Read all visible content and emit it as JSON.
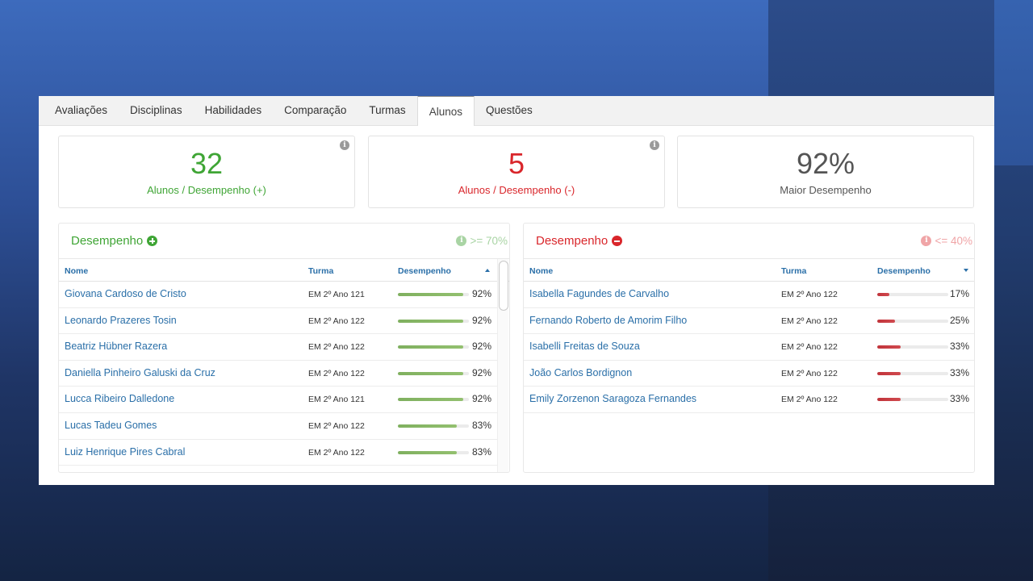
{
  "tabs": [
    {
      "label": "Avaliações",
      "active": false
    },
    {
      "label": "Disciplinas",
      "active": false
    },
    {
      "label": "Habilidades",
      "active": false
    },
    {
      "label": "Comparação",
      "active": false
    },
    {
      "label": "Turmas",
      "active": false
    },
    {
      "label": "Alunos",
      "active": true
    },
    {
      "label": "Questões",
      "active": false
    }
  ],
  "stats": [
    {
      "value": "32",
      "label": "Alunos / Desempenho (+)",
      "color": "#3fa535",
      "info_icon": "i"
    },
    {
      "value": "5",
      "label": "Alunos / Desempenho (-)",
      "color": "#d9262b",
      "info_icon": "i"
    },
    {
      "value": "92%",
      "label": "Maior Desempenho",
      "color": "#555555"
    }
  ],
  "positive": {
    "title": "Desempenho",
    "threshold": ">= 70%",
    "info_icon": "i",
    "columns": {
      "name": "Nome",
      "turma": "Turma",
      "desempenho": "Desempenho"
    },
    "sort": "ascending-icon",
    "rows": [
      {
        "name": "Giovana Cardoso de Cristo",
        "turma": "EM 2º Ano 121",
        "pct": "92%",
        "value": 92
      },
      {
        "name": "Leonardo Prazeres Tosin",
        "turma": "EM 2º Ano 122",
        "pct": "92%",
        "value": 92
      },
      {
        "name": "Beatriz Hübner Razera",
        "turma": "EM 2º Ano 122",
        "pct": "92%",
        "value": 92
      },
      {
        "name": "Daniella Pinheiro Galuski da Cruz",
        "turma": "EM 2º Ano 122",
        "pct": "92%",
        "value": 92
      },
      {
        "name": "Lucca Ribeiro Dalledone",
        "turma": "EM 2º Ano 121",
        "pct": "92%",
        "value": 92
      },
      {
        "name": "Lucas Tadeu Gomes",
        "turma": "EM 2º Ano 122",
        "pct": "83%",
        "value": 83
      },
      {
        "name": "Luiz Henrique Pires Cabral",
        "turma": "EM 2º Ano 122",
        "pct": "83%",
        "value": 83
      }
    ],
    "bar_color": "#85b565"
  },
  "negative": {
    "title": "Desempenho",
    "threshold": "<= 40%",
    "info_icon": "i",
    "columns": {
      "name": "Nome",
      "turma": "Turma",
      "desempenho": "Desempenho"
    },
    "sort": "descending-icon",
    "rows": [
      {
        "name": "Isabella Fagundes de Carvalho",
        "turma": "EM 2º Ano 122",
        "pct": "17%",
        "value": 17
      },
      {
        "name": "Fernando Roberto de Amorim Filho",
        "turma": "EM 2º Ano 122",
        "pct": "25%",
        "value": 25
      },
      {
        "name": "Isabelli Freitas de Souza",
        "turma": "EM 2º Ano 122",
        "pct": "33%",
        "value": 33
      },
      {
        "name": "João Carlos Bordignon",
        "turma": "EM 2º Ano 122",
        "pct": "33%",
        "value": 33
      },
      {
        "name": "Emily Zorzenon Saragoza Fernandes",
        "turma": "EM 2º Ano 122",
        "pct": "33%",
        "value": 33
      }
    ],
    "bar_color": "#c8393f"
  }
}
